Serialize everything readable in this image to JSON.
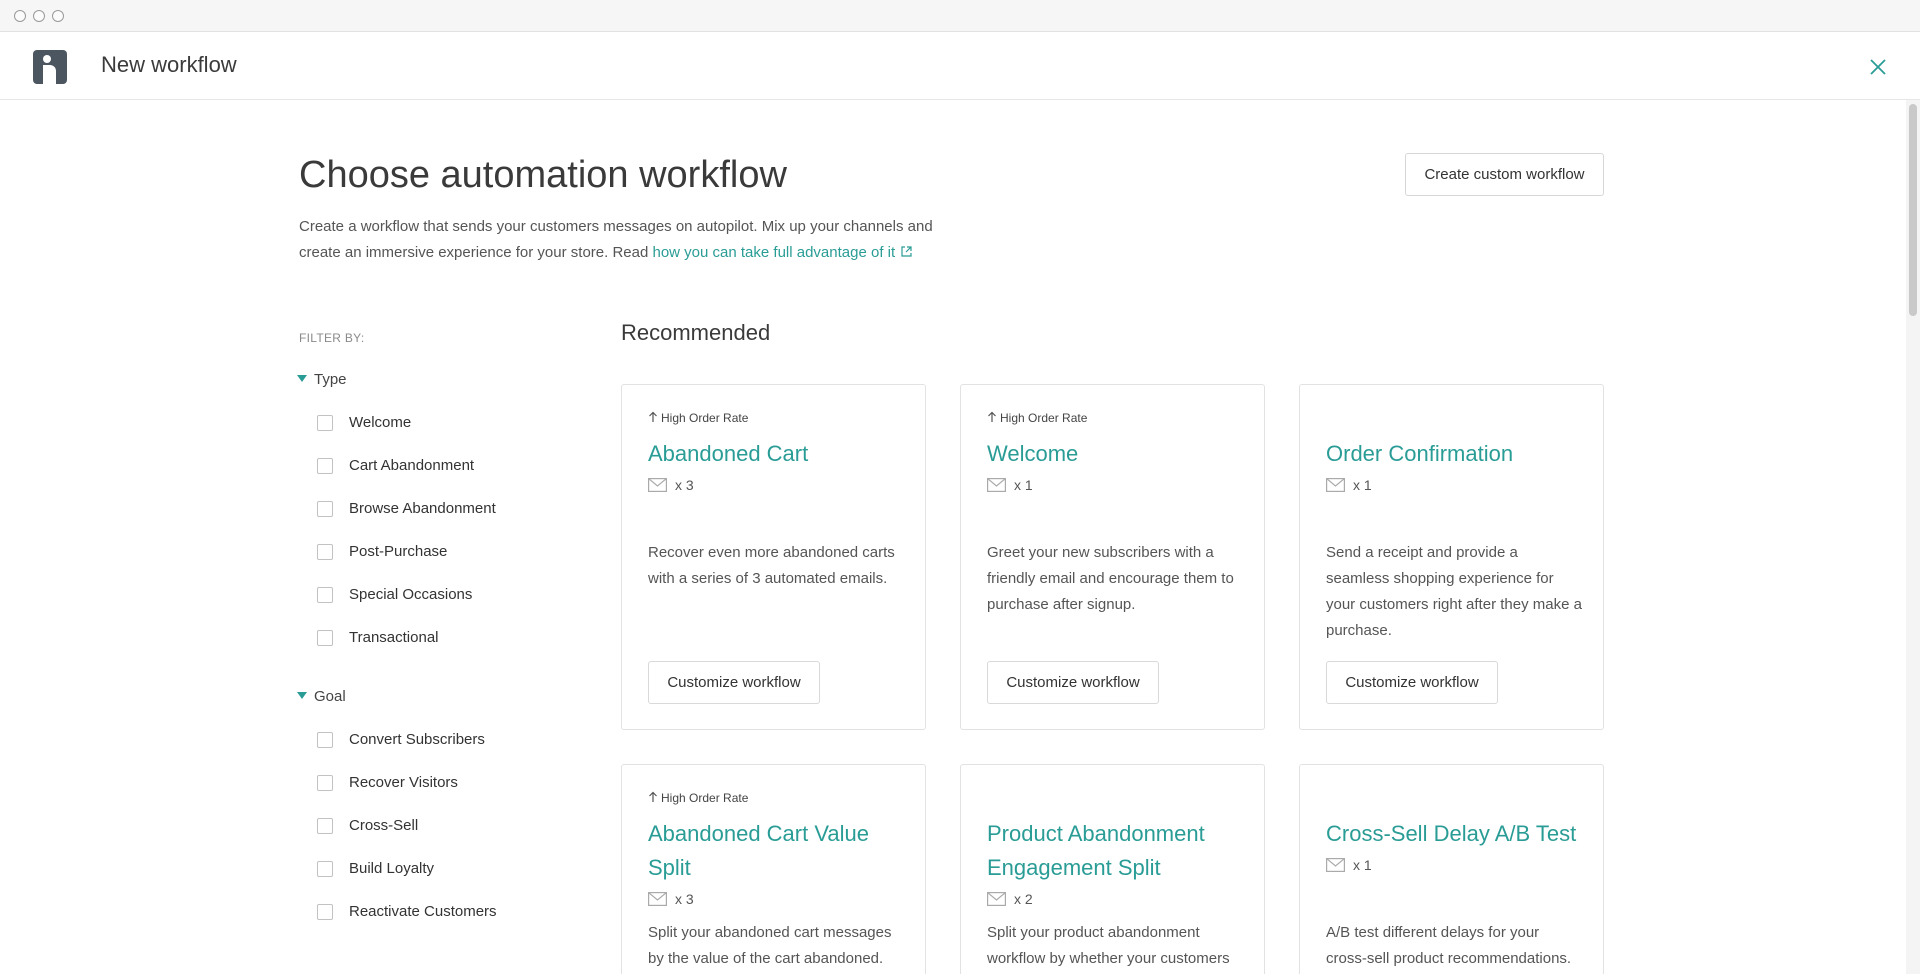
{
  "header": {
    "title": "New workflow"
  },
  "page": {
    "title": "Choose automation workflow",
    "custom_button": "Create custom workflow",
    "intro_text": "Create a workflow that sends your customers messages on autopilot. Mix up your channels and create an immersive experience for your store. Read ",
    "intro_link": "how you can take full advantage of it"
  },
  "filters": {
    "label": "FILTER BY:",
    "groups": [
      {
        "name": "Type",
        "options": [
          "Welcome",
          "Cart Abandonment",
          "Browse Abandonment",
          "Post-Purchase",
          "Special Occasions",
          "Transactional"
        ]
      },
      {
        "name": "Goal",
        "options": [
          "Convert Subscribers",
          "Recover Visitors",
          "Cross-Sell",
          "Build Loyalty",
          "Reactivate Customers"
        ]
      }
    ]
  },
  "recommended": {
    "title": "Recommended",
    "button_label": "Customize workflow",
    "cards": [
      {
        "badge": "High Order Rate",
        "title": "Abandoned Cart",
        "count": "x 3",
        "description": "Recover even more abandoned carts with a series of 3 automated emails."
      },
      {
        "badge": "High Order Rate",
        "title": "Welcome",
        "count": "x 1",
        "description": "Greet your new subscribers with a friendly email and encourage them to purchase after signup."
      },
      {
        "badge": "",
        "title": "Order Confirmation",
        "count": "x 1",
        "description": "Send a receipt and provide a seamless shopping experience for your customers right after they make a purchase."
      },
      {
        "badge": "High Order Rate",
        "title": "Abandoned Cart Value Split",
        "count": "x 3",
        "description": "Split your abandoned cart messages by the value of the cart abandoned."
      },
      {
        "badge": "",
        "title": "Product Abandonment Engagement Split",
        "count": "x 2",
        "description": "Split your product abandonment workflow by whether your customers"
      },
      {
        "badge": "",
        "title": "Cross-Sell Delay A/B Test",
        "count": "x 1",
        "description": "A/B test different delays for your cross-sell product recommendations."
      }
    ]
  },
  "colors": {
    "accent": "#2a9c96",
    "border": "#e2e2e2",
    "text": "#3a3a3a"
  }
}
